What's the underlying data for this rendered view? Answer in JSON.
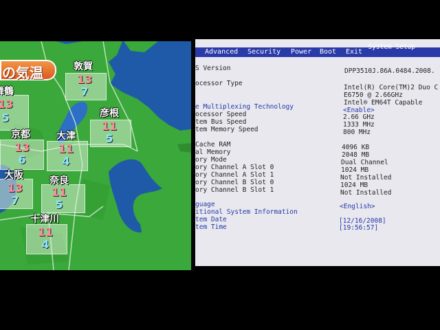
{
  "weather": {
    "title": "の気温",
    "cities": [
      {
        "name": "敦賀",
        "high": "13",
        "low": "7"
      },
      {
        "name": "舞鶴",
        "high": "13",
        "low": "5"
      },
      {
        "name": "彦根",
        "high": "11",
        "low": "5"
      },
      {
        "name": "京都",
        "high": "13",
        "low": "6"
      },
      {
        "name": "大津",
        "high": "11",
        "low": "4"
      },
      {
        "name": "大阪",
        "high": "13",
        "low": "7"
      },
      {
        "name": "奈良",
        "high": "11",
        "low": "5"
      },
      {
        "name": "十津川",
        "high": "11",
        "low": "4"
      }
    ],
    "colors": {
      "sea": "#1f5aa8",
      "land": "#3aa83a",
      "high": "#ff8a9a",
      "low": "#8fe6ff"
    }
  },
  "bios": {
    "title": "System Setup",
    "menu": [
      "Advanced",
      "Security",
      "Power",
      "Boot",
      "Exit"
    ],
    "rows": [
      {
        "label": "S Version",
        "value": "DPP3510J.86A.0484.2008."
      },
      {
        "label": "ocessor Type",
        "value": "Intel(R) Core(TM)2 Duo C"
      },
      {
        "label": "",
        "value": "E6750  @ 2.66GHz"
      },
      {
        "label": "",
        "value": "Intel® EM64T Capable"
      },
      {
        "label": "e Multiplexing Technology",
        "value": "<Enable>"
      },
      {
        "label": "ocessor Speed",
        "value": "2.66 GHz"
      },
      {
        "label": "tem Bus Speed",
        "value": "1333 MHz"
      },
      {
        "label": "tem Memory Speed",
        "value": "800 MHz"
      },
      {
        "label": "Cache RAM",
        "value": "4096 KB"
      },
      {
        "label": "al Memory",
        "value": "2048 MB"
      },
      {
        "label": "ory Mode",
        "value": "Dual Channel"
      },
      {
        "label": "ory Channel A Slot 0",
        "value": "1024 MB"
      },
      {
        "label": "ory Channel A Slot 1",
        "value": "Not Installed"
      },
      {
        "label": "ory Channel B Slot 0",
        "value": "1024 MB"
      },
      {
        "label": "ory Channel B Slot 1",
        "value": "Not Installed"
      },
      {
        "label": "guage",
        "value": "<English>"
      },
      {
        "label": "itional System Information",
        "value": ""
      },
      {
        "label": "tem Date",
        "value": "[12/16/2008]"
      },
      {
        "label": "tem Time",
        "value": "[19:56:57]"
      }
    ],
    "colors": {
      "menu_bar": "#2a3aa8",
      "background": "#e9e8ee",
      "highlight": "#2437a8"
    }
  }
}
